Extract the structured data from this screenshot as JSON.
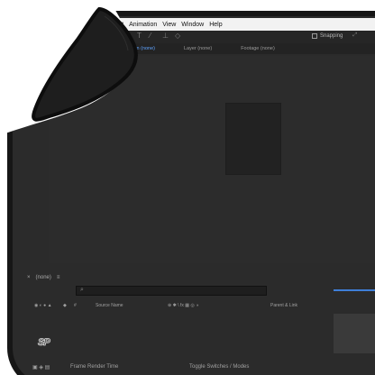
{
  "menu": {
    "items": [
      "ffect",
      "Animation",
      "View",
      "Window",
      "Help"
    ]
  },
  "toolbar": {
    "snapping_label": "Snapping"
  },
  "panels": {
    "composition_tab": "Composition (none)",
    "layer_tab": "Layer (none)",
    "footage_tab": "Footage (none)"
  },
  "timeline": {
    "comp_name": "(none)",
    "columns": {
      "hash": "#",
      "source_name": "Source Name",
      "parent": "Parent & Link"
    },
    "status_left": "Frame Render Time",
    "status_center": "Toggle Switches / Modes"
  },
  "logo": {
    "text": "SP"
  },
  "colors": {
    "pad": "#2b2b2b",
    "stitch": "#161616",
    "accent_blue": "#3e7fd8"
  }
}
